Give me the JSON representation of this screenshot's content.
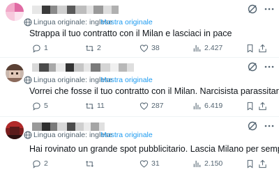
{
  "tweets": [
    {
      "translated_label": "Lingua originale: inglese",
      "show_original": "Mostra originale",
      "text": "Strappa il tuo contratto con il Milan e lasciaci in pace",
      "replies": "1",
      "reposts": "2",
      "likes": "38",
      "views": "2.427"
    },
    {
      "translated_label": "Lingua originale: inglese",
      "show_original": "Mostra originale",
      "text": "Vorrei che fosse il tuo contratto con il Milan. Narcisista parassitario",
      "replies": "5",
      "reposts": "11",
      "likes": "287",
      "views": "6.419"
    },
    {
      "translated_label": "Lingua originale: inglese",
      "show_original": "Mostra originale",
      "text": "Hai rovinato un grande spot pubblicitario. Lascia Milano per sempre.",
      "replies": "2",
      "reposts": "",
      "likes": "31",
      "views": "2.150"
    }
  ],
  "colors": {
    "accent": "#1d9bf0",
    "muted": "#536471",
    "text": "#0f1419",
    "separator": "#eff3f4"
  },
  "icons": [
    "globe-icon",
    "reply-icon",
    "repost-icon",
    "like-icon",
    "views-icon",
    "bookmark-icon",
    "share-icon",
    "grok-icon",
    "more-icon"
  ]
}
